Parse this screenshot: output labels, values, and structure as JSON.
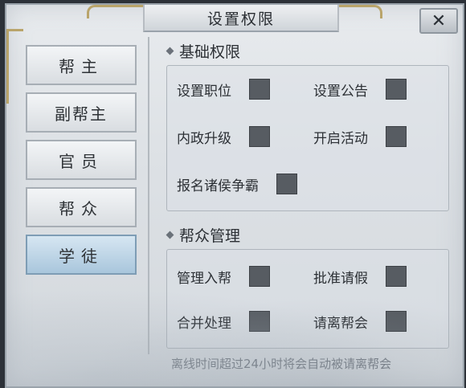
{
  "window": {
    "title": "设置权限",
    "close_label": "✕"
  },
  "tabs": [
    {
      "label": "帮主",
      "selected": false
    },
    {
      "label": "副帮主",
      "selected": false
    },
    {
      "label": "官员",
      "selected": false
    },
    {
      "label": "帮众",
      "selected": false
    },
    {
      "label": "学徒",
      "selected": true
    }
  ],
  "sections": {
    "basic": {
      "title": "基础权限",
      "permissions": [
        {
          "label": "设置职位",
          "checked": false
        },
        {
          "label": "设置公告",
          "checked": false
        },
        {
          "label": "内政升级",
          "checked": false
        },
        {
          "label": "开启活动",
          "checked": false
        },
        {
          "label": "报名诸侯争霸",
          "checked": false
        }
      ]
    },
    "members": {
      "title": "帮众管理",
      "permissions": [
        {
          "label": "管理入帮",
          "checked": false
        },
        {
          "label": "批准请假",
          "checked": false
        },
        {
          "label": "合并处理",
          "checked": false
        },
        {
          "label": "请离帮会",
          "checked": false
        }
      ]
    }
  },
  "footer_note": "离线时间超过24小时将会自动被请离帮会",
  "colors": {
    "selected_tab": "#a9c6dc",
    "checkbox": "#575c62",
    "accent_gold": "#b9a46a"
  }
}
